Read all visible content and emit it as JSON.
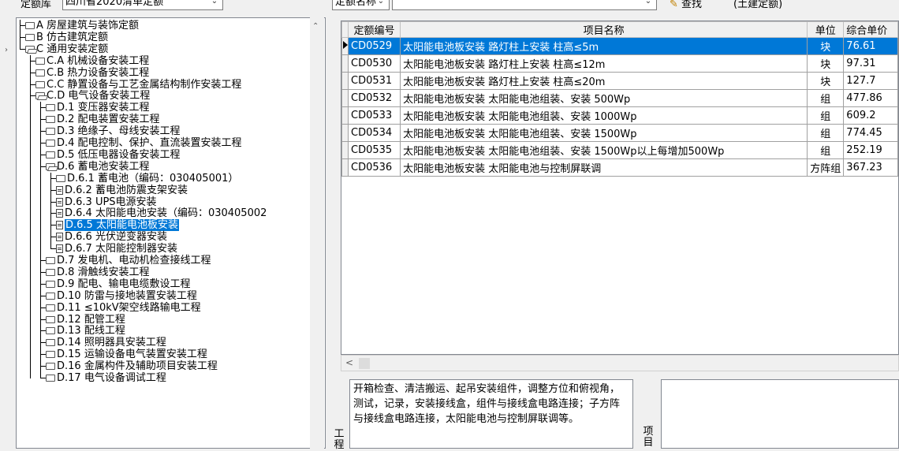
{
  "toolbar": {
    "library_label": "定额库",
    "library_value": "四川省2020清单定额",
    "search_type_value": "定额名称",
    "search_input_value": "",
    "find_label": "查找",
    "mode_label": "(土建定额)"
  },
  "tree": {
    "items": [
      {
        "label": "A 房屋建筑与装饰定额",
        "kind": "folder"
      },
      {
        "label": "B 仿古建筑定额",
        "kind": "folder"
      },
      {
        "label": "C 通用安装定额",
        "kind": "folder-open"
      },
      {
        "label": "C.A 机械设备安装工程",
        "kind": "folder"
      },
      {
        "label": "C.B 热力设备安装工程",
        "kind": "folder"
      },
      {
        "label": "C.C 静置设备与工艺金属结构制作安装工程",
        "kind": "folder"
      },
      {
        "label": "C.D 电气设备安装工程",
        "kind": "folder-open"
      },
      {
        "label": "D.1 变压器安装工程",
        "kind": "folder"
      },
      {
        "label": "D.2 配电装置安装工程",
        "kind": "folder"
      },
      {
        "label": "D.3 绝缘子、母线安装工程",
        "kind": "folder"
      },
      {
        "label": "D.4 配电控制、保护、直流装置安装工程",
        "kind": "folder"
      },
      {
        "label": "D.5 低压电器设备安装工程",
        "kind": "folder"
      },
      {
        "label": "D.6 蓄电池安装工程",
        "kind": "folder-open"
      },
      {
        "label": "D.6.1 蓄电池（编码：030405001）",
        "kind": "folder"
      },
      {
        "label": "D.6.2 蓄电池防震支架安装",
        "kind": "doc"
      },
      {
        "label": "D.6.3 UPS电源安装",
        "kind": "doc"
      },
      {
        "label": "D.6.4 太阳能电池安装（编码：030405002",
        "kind": "doc"
      },
      {
        "label": "D.6.5 太阳能电池板安装",
        "kind": "doc"
      },
      {
        "label": "D.6.6 光伏逆变器安装",
        "kind": "doc"
      },
      {
        "label": "D.6.7 太阳能控制器安装",
        "kind": "doc"
      },
      {
        "label": "D.7 发电机、电动机检查接线工程",
        "kind": "folder"
      },
      {
        "label": "D.8 滑触线安装工程",
        "kind": "folder"
      },
      {
        "label": "D.9 配电、输电电缆敷设工程",
        "kind": "folder"
      },
      {
        "label": "D.10 防雷与接地装置安装工程",
        "kind": "folder"
      },
      {
        "label": "D.11 ≤10kV架空线路输电工程",
        "kind": "folder"
      },
      {
        "label": "D.12 配管工程",
        "kind": "folder"
      },
      {
        "label": "D.13 配线工程",
        "kind": "folder"
      },
      {
        "label": "D.14 照明器具安装工程",
        "kind": "folder"
      },
      {
        "label": "D.15 运输设备电气装置安装工程",
        "kind": "folder"
      },
      {
        "label": "D.16 金属构件及辅助项目安装工程",
        "kind": "folder"
      },
      {
        "label": "D.17 电气设备调试工程",
        "kind": "folder"
      }
    ]
  },
  "grid": {
    "headers": [
      "定额编号",
      "项目名称",
      "单位",
      "综合单价"
    ],
    "rows": [
      {
        "code": "CD0529",
        "name": "太阳能电池板安装 路灯柱上安装 柱高≤5m",
        "unit": "块",
        "price": "76.61"
      },
      {
        "code": "CD0530",
        "name": "太阳能电池板安装 路灯柱上安装 柱高≤12m",
        "unit": "块",
        "price": "97.31"
      },
      {
        "code": "CD0531",
        "name": "太阳能电池板安装 路灯柱上安装 柱高≤20m",
        "unit": "块",
        "price": "127.7"
      },
      {
        "code": "CD0532",
        "name": "太阳能电池板安装 太阳能电池组装、安装 500Wp",
        "unit": "组",
        "price": "477.86"
      },
      {
        "code": "CD0533",
        "name": "太阳能电池板安装 太阳能电池组装、安装 1000Wp",
        "unit": "组",
        "price": "609.2"
      },
      {
        "code": "CD0534",
        "name": "太阳能电池板安装 太阳能电池组装、安装 1500Wp",
        "unit": "组",
        "price": "774.45"
      },
      {
        "code": "CD0535",
        "name": "太阳能电池板安装 太阳能电池组装、安装 1500Wp以上每增加500Wp",
        "unit": "组",
        "price": "252.19"
      },
      {
        "code": "CD0536",
        "name": "太阳能电池板安装 太阳能电池与控制屏联调",
        "unit": "方阵组",
        "price": "367.23"
      }
    ]
  },
  "bottom": {
    "work_label": "工程",
    "description": "开箱检查、清洁搬运、起吊安装组件，调整方位和俯视角，测试，记录，安装接线盒，组件与接线盒电路连接；子方阵与接线盒电路连接，太阳能电池与控制屏联调等。",
    "item_label": "项目"
  },
  "colors": {
    "selection": "#0078d7"
  }
}
